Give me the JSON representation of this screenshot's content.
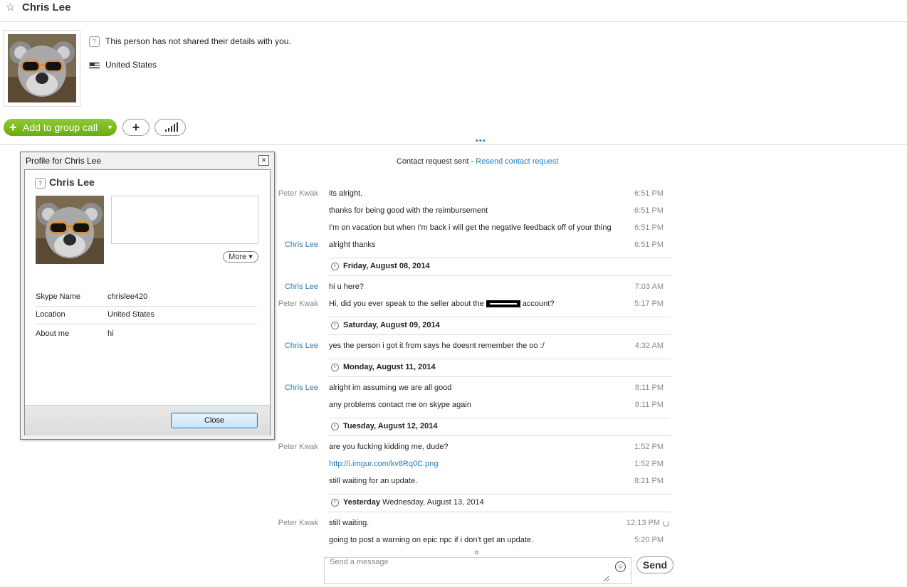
{
  "header": {
    "title": "Chris Lee"
  },
  "contact": {
    "details_notice": "This person has not shared their details with you.",
    "country": "United States"
  },
  "actions": {
    "add_to_group_call": "Add to group call",
    "add_plus": "+"
  },
  "chat": {
    "request_text": "Contact request sent - ",
    "resend_link": "Resend contact request",
    "rows": [
      {
        "sender": "Peter Kwak",
        "text": "its alright.",
        "time": "6:51 PM"
      },
      {
        "sender": "",
        "text": "thanks for being good with the reimbursement",
        "time": "6:51 PM"
      },
      {
        "sender": "",
        "text": "I'm on vacation but when I'm back i will get the negative feedback off of your thing",
        "time": "6:51 PM"
      },
      {
        "sender": "Chris Lee",
        "text": "alright thanks",
        "time": "6:51 PM"
      },
      {
        "sender": "Chris Lee",
        "text": "hi u here?",
        "time": "7:03 AM"
      },
      {
        "sender": "Peter Kwak",
        "text_before": "Hi, did you ever speak to the seller about the ",
        "text_after": " account?",
        "time": "5:17 PM"
      },
      {
        "sender": "Chris Lee",
        "text": "yes the person i got it from says he doesnt remember the oo :/",
        "time": "4:32 AM"
      },
      {
        "sender": "Chris Lee",
        "text": "alright im assuming we are all good",
        "time": "8:11 PM"
      },
      {
        "sender": "",
        "text": "any problems contact me on skype again",
        "time": "8:11 PM"
      },
      {
        "sender": "Peter Kwak",
        "text": "are you fucking kidding me, dude?",
        "time": "1:52 PM"
      },
      {
        "sender": "",
        "text": "http://i.imgur.com/kv8Rq0C.png",
        "time": "1:52 PM"
      },
      {
        "sender": "",
        "text": "still waiting for an update.",
        "time": "8:21 PM"
      },
      {
        "sender": "Peter Kwak",
        "text": "still waiting.",
        "time": "12:13 PM"
      },
      {
        "sender": "",
        "text": "going to post a warning on epic npc if i don't get an update.",
        "time": "5:20 PM"
      }
    ],
    "days": [
      {
        "bold": "Friday, August 08, 2014",
        "rest": ""
      },
      {
        "bold": "Saturday, August 09, 2014",
        "rest": ""
      },
      {
        "bold": "Monday, August 11, 2014",
        "rest": ""
      },
      {
        "bold": "Tuesday, August 12, 2014",
        "rest": ""
      },
      {
        "bold": "Yesterday",
        "rest": " Wednesday, August 13, 2014"
      }
    ]
  },
  "composer": {
    "placeholder": "Send a message",
    "send_label": "Send"
  },
  "dialog": {
    "title": "Profile for Chris Lee",
    "name": "Chris Lee",
    "more_label": "More",
    "fields": {
      "skype_name_label": "Skype Name",
      "skype_name": "chrislee420",
      "location_label": "Location",
      "location": "United States",
      "about_label": "About me",
      "about": "hi"
    },
    "close_label": "Close"
  },
  "colors": {
    "accent_green": "#7dbb22",
    "link_blue": "#1f7bbd",
    "chris_blue": "#2a7ab0"
  }
}
